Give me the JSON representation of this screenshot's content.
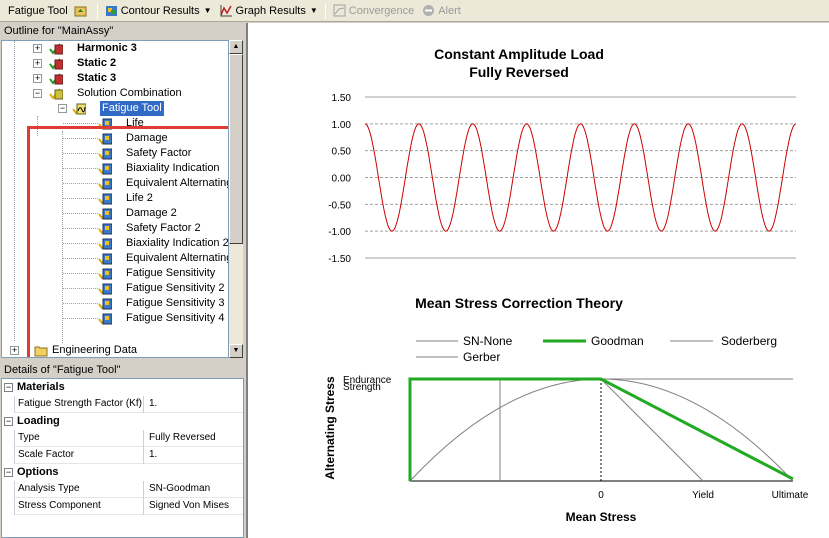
{
  "toolbar": {
    "fatigue_tool": "Fatigue Tool",
    "contour_results": "Contour Results",
    "graph_results": "Graph Results",
    "convergence": "Convergence",
    "alert": "Alert"
  },
  "outline": {
    "title": "Outline for \"MainAssy\"",
    "items": [
      {
        "label": "Harmonic 3"
      },
      {
        "label": "Static 2"
      },
      {
        "label": "Static 3"
      },
      {
        "label": "Solution Combination"
      },
      {
        "label": "Fatigue Tool"
      },
      {
        "label": "Life"
      },
      {
        "label": "Damage"
      },
      {
        "label": "Safety Factor"
      },
      {
        "label": "Biaxiality Indication"
      },
      {
        "label": "Equivalent Alternating S"
      },
      {
        "label": "Life 2"
      },
      {
        "label": "Damage 2"
      },
      {
        "label": "Safety Factor 2"
      },
      {
        "label": "Biaxiality Indication 2"
      },
      {
        "label": "Equivalent Alternating S"
      },
      {
        "label": "Fatigue Sensitivity"
      },
      {
        "label": "Fatigue Sensitivity 2"
      },
      {
        "label": "Fatigue Sensitivity 3"
      },
      {
        "label": "Fatigue Sensitivity 4"
      },
      {
        "label": "Engineering Data"
      }
    ]
  },
  "details": {
    "title": "Details of \"Fatigue Tool\"",
    "materials": {
      "label": "Materials",
      "rows": [
        {
          "name": "Fatigue Strength Factor (Kf)",
          "value": "1."
        }
      ]
    },
    "loading": {
      "label": "Loading",
      "rows": [
        {
          "name": "Type",
          "value": "Fully Reversed"
        },
        {
          "name": "Scale Factor",
          "value": "1."
        }
      ]
    },
    "options": {
      "label": "Options",
      "rows": [
        {
          "name": "Analysis Type",
          "value": "SN-Goodman"
        },
        {
          "name": "Stress Component",
          "value": "Signed Von Mises"
        }
      ]
    }
  },
  "chart_data": [
    {
      "type": "line",
      "title": "Constant Amplitude Load",
      "subtitle": "Fully Reversed",
      "ylim": [
        -1.5,
        1.5
      ],
      "yticks": [
        "1.50",
        "1.00",
        "0.50",
        "0.00",
        "-0.50",
        "-1.00",
        "-1.50"
      ],
      "grid": true,
      "cycles": 8,
      "amplitude": 1.0,
      "series_color": "#cc0000"
    },
    {
      "type": "line",
      "title": "Mean Stress Correction Theory",
      "xlabel": "Mean Stress",
      "ylabel": "Alternating Stress",
      "xticks": [
        "0",
        "Yield",
        "Ultimate"
      ],
      "yticks": [
        "Endurance",
        "Strength"
      ],
      "legend": [
        {
          "name": "SN-None",
          "color": "#808080"
        },
        {
          "name": "Goodman",
          "color": "#22aa22"
        },
        {
          "name": "Soderberg",
          "color": "#808080"
        },
        {
          "name": "Gerber",
          "color": "#808080"
        }
      ],
      "selected": "Goodman"
    }
  ]
}
